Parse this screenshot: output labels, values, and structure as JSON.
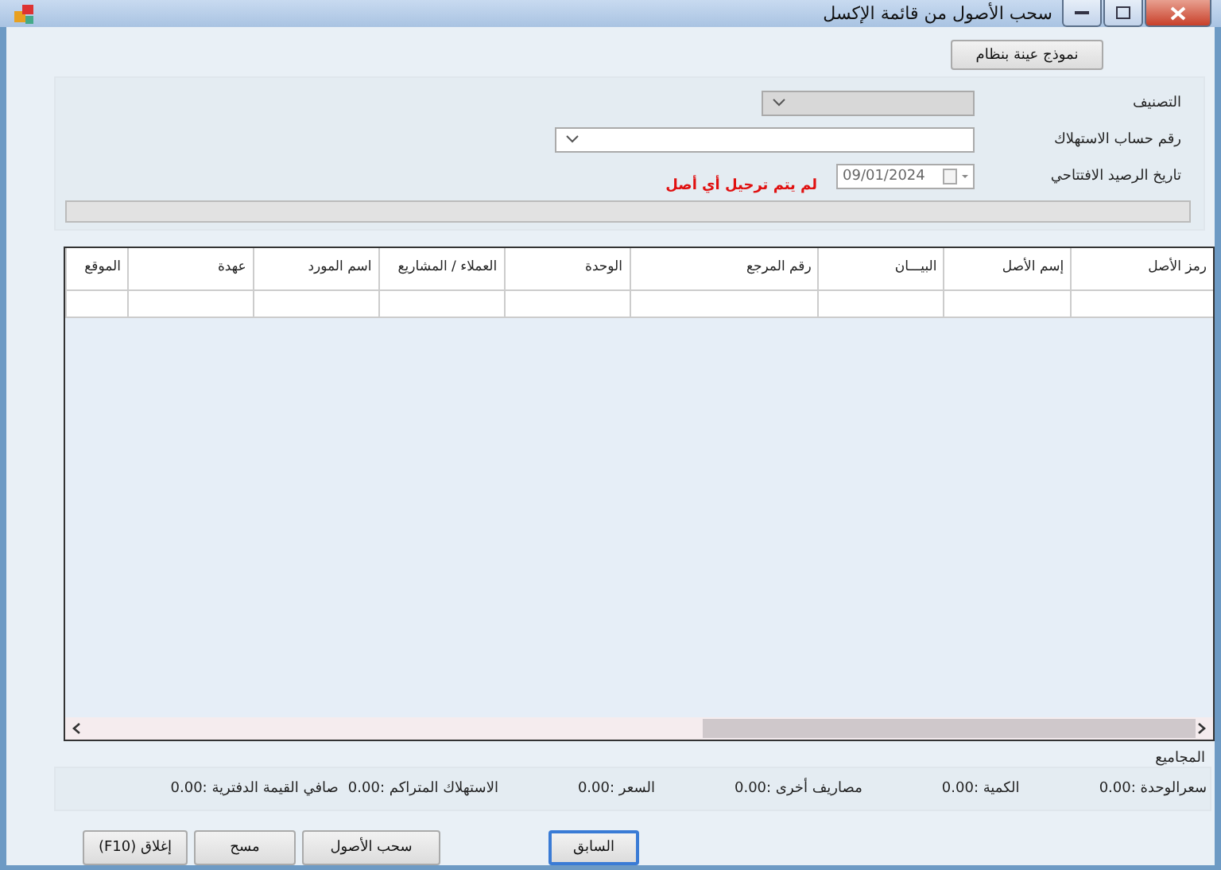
{
  "window": {
    "title": "سحب الأصول من قائمة الإكسل"
  },
  "sample_button": "نموذج عينة بنظام",
  "fields": [
    {
      "label": "التصنيف",
      "kind": "combo",
      "disabled": true
    },
    {
      "label": "رقم حساب الاستهلاك",
      "kind": "combo",
      "disabled": false
    },
    {
      "label": "تاريخ الرصيد الافتتاحي",
      "kind": "date",
      "value": "09/01/2024",
      "disabled": false
    }
  ],
  "status_message": "لم يتم ترحيل أي أصل",
  "progress": {
    "level": 0
  },
  "table": {
    "columns": [
      "رمز الأصل",
      "إسم الأصل",
      "البيـــان",
      "رقم المرجع",
      "الوحدة",
      "العملاء / المشاريع",
      "اسم المورد",
      "عهدة",
      "الموقع"
    ]
  },
  "totals": {
    "title": "المجاميع",
    "items": [
      "سعرالوحدة :0.00",
      "الكمية :0.00",
      "مصاريف أخرى :0.00",
      "السعر :0.00",
      "الاستهلاك المتراكم :0.00",
      "صافي القيمة الدفترية :0.00"
    ]
  },
  "buttons": [
    {
      "label": "السابق",
      "selected": true
    },
    {
      "label": "سحب الأصول",
      "selected": false
    },
    {
      "label": "مسح",
      "selected": false
    },
    {
      "label": "إغلاق (F10)",
      "selected": false
    }
  ]
}
